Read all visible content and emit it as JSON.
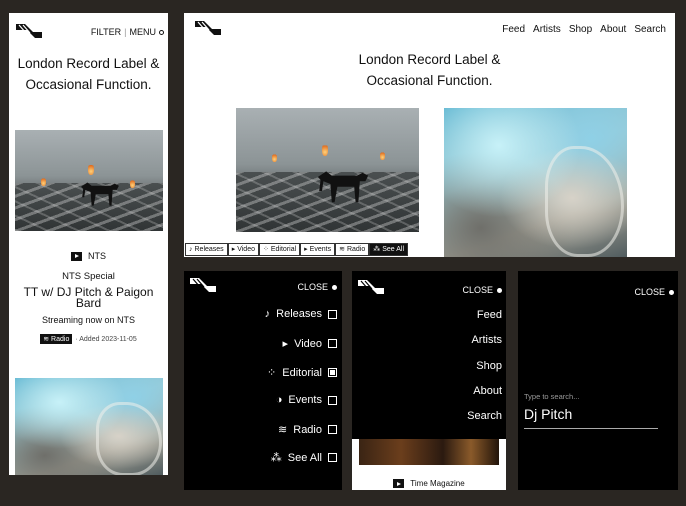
{
  "mobile_home": {
    "nav": {
      "filter": "FILTER",
      "separator": "|",
      "menu": "MENU",
      "menu_icon": "circle-icon"
    },
    "tagline_line1": "London Record Label &",
    "tagline_line2": "Occasional Function.",
    "feature": {
      "source": "NTS",
      "type": "NTS Special",
      "title": "TT w/ DJ Pitch & Paigon Bard",
      "subtitle": "Streaming now on NTS",
      "category": "≋ Radio",
      "added": "· Added 2023-11-05"
    }
  },
  "desktop_home": {
    "nav": [
      "Feed",
      "Artists",
      "Shop",
      "About",
      "Search"
    ],
    "tagline_line1": "London Record Label &",
    "tagline_line2": "Occasional Function.",
    "filters": [
      {
        "icon": "♪",
        "label": "Releases",
        "active": false
      },
      {
        "icon": "▸",
        "label": "Video",
        "active": false
      },
      {
        "icon": "⁘",
        "label": "Editorial",
        "active": false
      },
      {
        "icon": "▸",
        "label": "Events",
        "active": false
      },
      {
        "icon": "≋",
        "label": "Radio",
        "active": false
      },
      {
        "icon": "⁂",
        "label": "See All",
        "active": true
      }
    ]
  },
  "filter_menu": {
    "close": "CLOSE",
    "items": [
      {
        "icon": "♪",
        "label": "Releases",
        "checked": false
      },
      {
        "icon": "▸",
        "label": "Video",
        "checked": false
      },
      {
        "icon": "⁘",
        "label": "Editorial",
        "checked": true
      },
      {
        "icon": "◑",
        "label": "Events",
        "checked": false
      },
      {
        "icon": "≋",
        "label": "Radio",
        "checked": false
      },
      {
        "icon": "⁂",
        "label": "See All",
        "checked": false
      }
    ]
  },
  "nav_menu": {
    "close": "CLOSE",
    "items": [
      "Feed",
      "Artists",
      "Shop",
      "About",
      "Search"
    ],
    "peek_text": "Time Magazine"
  },
  "search_menu": {
    "close": "CLOSE",
    "placeholder": "Type to search...",
    "query": "Dj Pitch"
  },
  "colors": {
    "background": "#2a2622",
    "panel_light": "#ffffff",
    "panel_dark": "#000000"
  }
}
